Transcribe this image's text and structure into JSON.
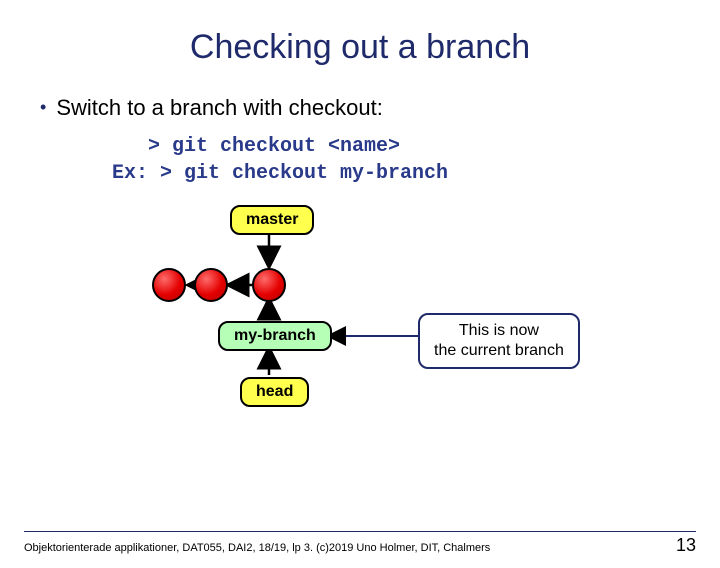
{
  "title": "Checking out a branch",
  "bullet": "Switch to a branch with checkout:",
  "code": {
    "line1": "   > git checkout <name>",
    "line2": "Ex: > git checkout my-branch"
  },
  "diagram": {
    "master_label": "master",
    "mybranch_label": "my-branch",
    "head_label": "head",
    "callout_line1": "This is now",
    "callout_line2": "the current branch"
  },
  "footer": {
    "text": "Objektorienterade applikationer, DAT055, DAI2, 18/19, lp 3. (c)2019 Uno Holmer, DIT, Chalmers",
    "page": "13"
  }
}
